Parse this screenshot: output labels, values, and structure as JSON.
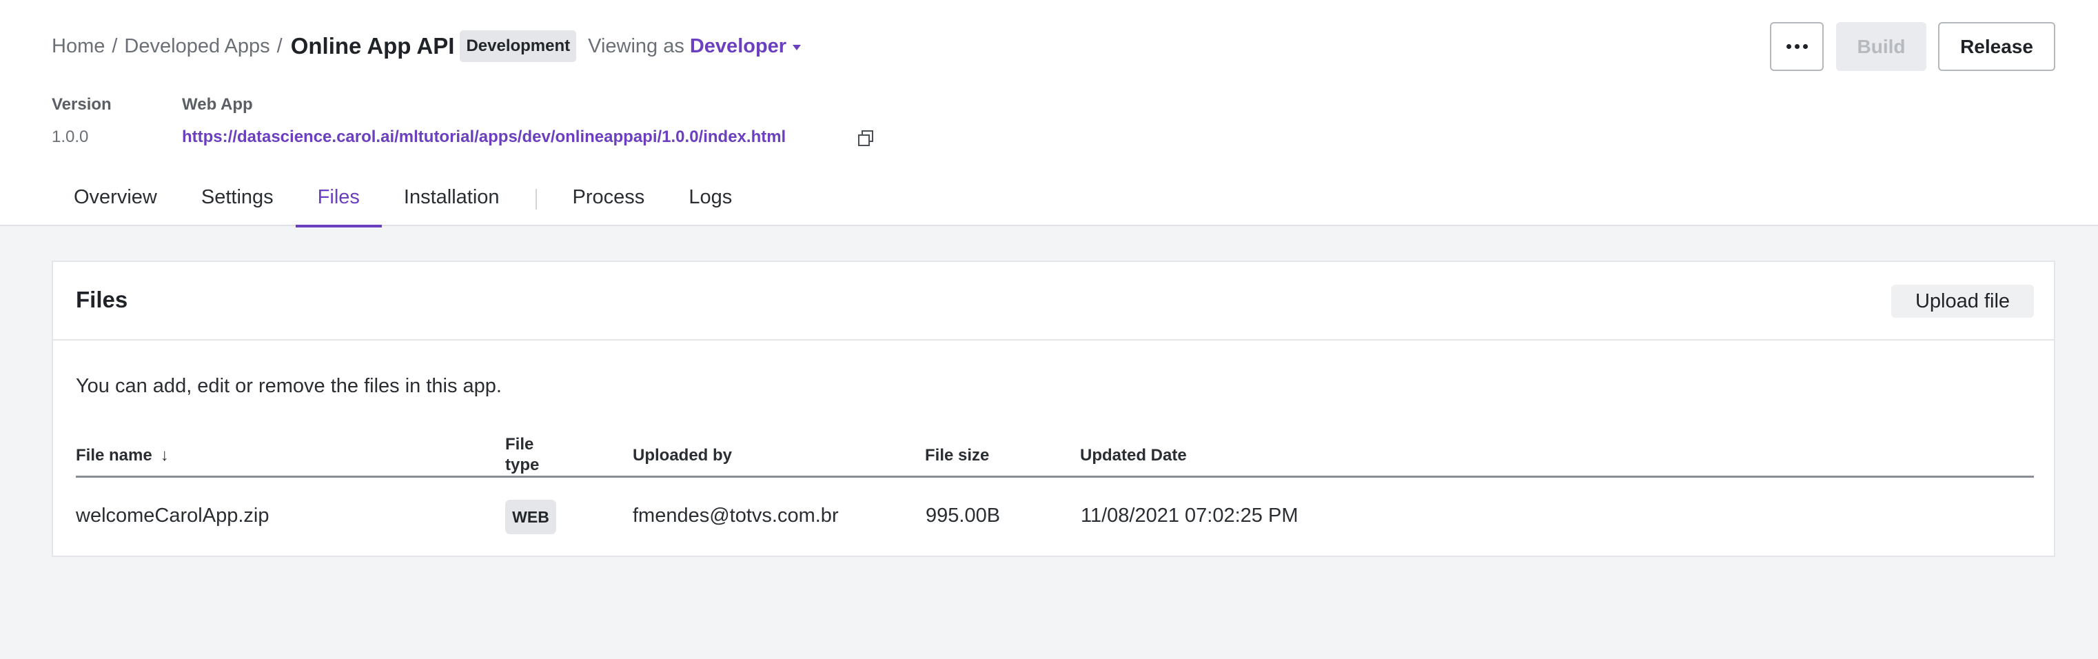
{
  "breadcrumb": {
    "items": [
      "Home",
      "Developed Apps"
    ],
    "separator": "/",
    "current": "Online App API",
    "badge": "Development"
  },
  "viewing": {
    "label": "Viewing as",
    "role": "Developer"
  },
  "actions": {
    "more_icon": "more-horizontal-icon",
    "build": "Build",
    "release": "Release"
  },
  "meta": {
    "version_label": "Version",
    "version_value": "1.0.0",
    "webapp_label": "Web App",
    "webapp_url": "https://datascience.carol.ai/mltutorial/apps/dev/onlineappapi/1.0.0/index.html",
    "copy_icon": "copy-icon"
  },
  "tabs": [
    {
      "label": "Overview",
      "active": false
    },
    {
      "label": "Settings",
      "active": false
    },
    {
      "label": "Files",
      "active": true
    },
    {
      "label": "Installation",
      "active": false
    },
    {
      "label": "Process",
      "active": false
    },
    {
      "label": "Logs",
      "active": false
    }
  ],
  "files": {
    "title": "Files",
    "upload_label": "Upload file",
    "description": "You can add, edit or remove the files in this app.",
    "columns": {
      "name": "File name",
      "type_line1": "File",
      "type_line2": "type",
      "uploaded_by": "Uploaded by",
      "size": "File size",
      "updated": "Updated Date"
    },
    "sort_icon": "arrow-down-icon",
    "rows": [
      {
        "name": "welcomeCarolApp.zip",
        "type": "WEB",
        "uploaded_by": "fmendes@totvs.com.br",
        "size": "995.00B",
        "updated": "11/08/2021 07:02:25 PM"
      }
    ]
  },
  "colors": {
    "accent": "#6b3fc0",
    "background": "#f3f4f6",
    "border": "#e3e5e8"
  }
}
